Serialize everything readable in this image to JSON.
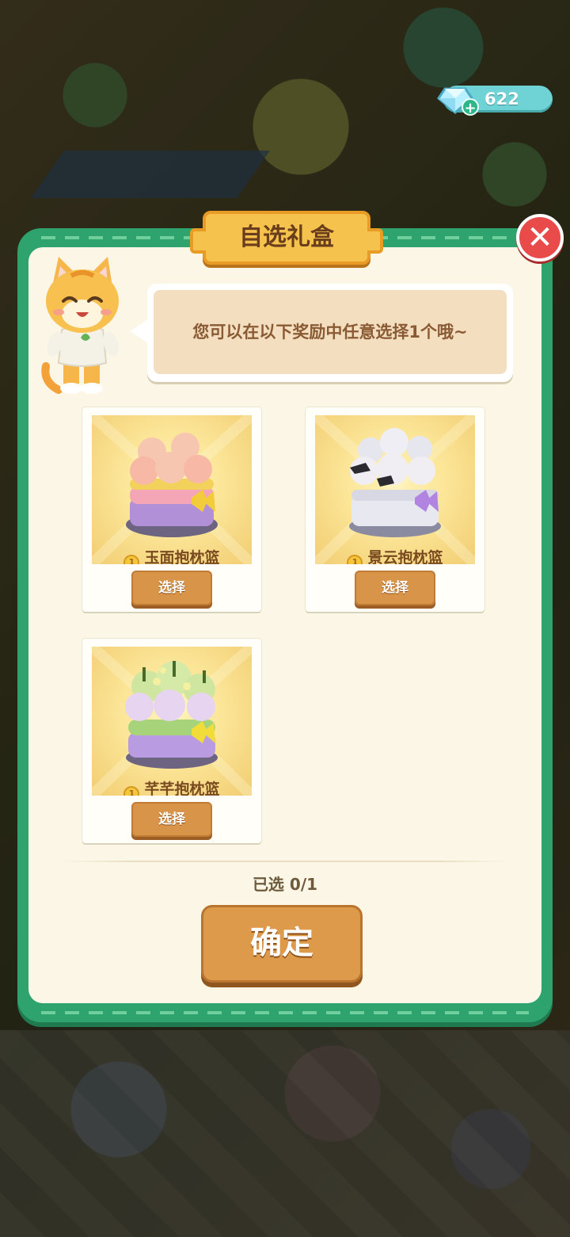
{
  "hud": {
    "gem_count": "622"
  },
  "dialog": {
    "title": "自选礼盒",
    "message": "您可以在以下奖励中任意选择1个哦~",
    "rewards": [
      {
        "name": "玉面抱枕篮",
        "button": "选择"
      },
      {
        "name": "景云抱枕篮",
        "button": "选择"
      },
      {
        "name": "芊芊抱枕篮",
        "button": "选择"
      }
    ],
    "selected_status": "已选 0/1",
    "confirm_label": "确定"
  },
  "colors": {
    "frame_green": "#2fa36d",
    "panel_cream": "#fbf6e5",
    "button_orange": "#dc9a4a",
    "close_red": "#e94b4b",
    "gem_teal": "#6fd3d6"
  }
}
